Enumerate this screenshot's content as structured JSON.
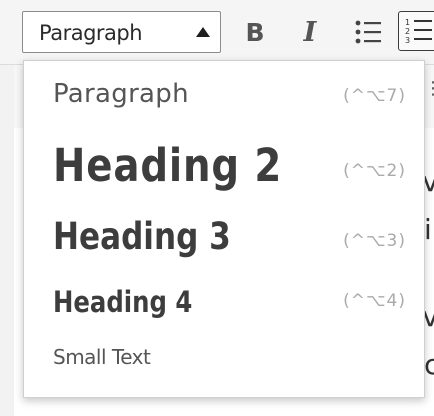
{
  "toolbar": {
    "format_select": {
      "value": "Paragraph"
    },
    "buttons": {
      "bold_label": "B",
      "italic_label": "I"
    }
  },
  "dropdown": {
    "options": [
      {
        "label": "Paragraph",
        "shortcut": "(^⌥7)"
      },
      {
        "label": "Heading 2",
        "shortcut": "(^⌥2)"
      },
      {
        "label": "Heading 3",
        "shortcut": "(^⌥3)"
      },
      {
        "label": "Heading 4",
        "shortcut": "(^⌥4)"
      },
      {
        "label": "Small Text",
        "shortcut": ""
      }
    ]
  },
  "editor": {
    "peek_chars": [
      "v",
      "i",
      "v",
      "c"
    ]
  },
  "colors": {
    "text": "#444444",
    "shortcut": "#aaaaaa",
    "border": "#8c8c8c"
  },
  "icons": [
    "caret-up-icon",
    "bulleted-list-icon",
    "numbered-list-icon",
    "more-options-icon"
  ]
}
